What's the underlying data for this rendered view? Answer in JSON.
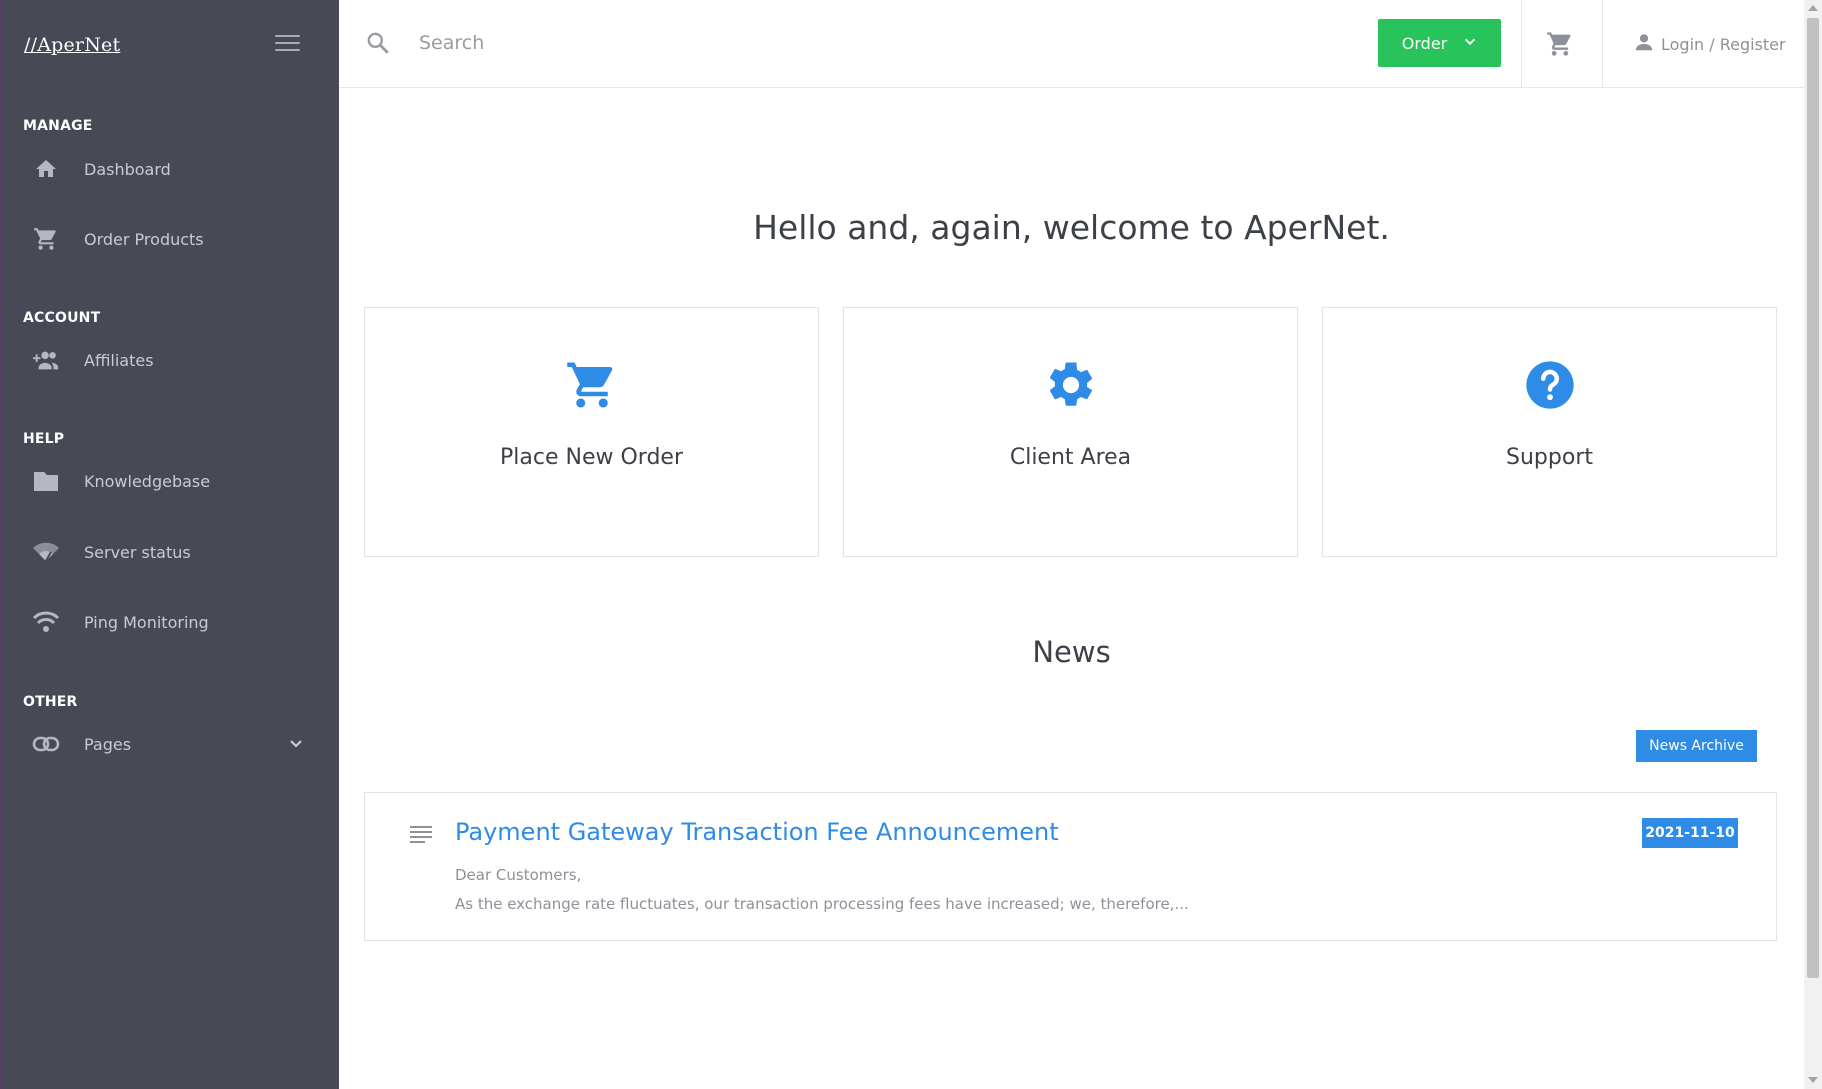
{
  "brand": {
    "name": "//AperNet"
  },
  "sidebar": {
    "sections": [
      {
        "title": "MANAGE"
      },
      {
        "title": "ACCOUNT"
      },
      {
        "title": "HELP"
      },
      {
        "title": "OTHER"
      }
    ],
    "items": [
      {
        "label": "Dashboard",
        "icon": "home-icon"
      },
      {
        "label": "Order Products",
        "icon": "cart-icon"
      },
      {
        "label": "Affiliates",
        "icon": "group-add-icon"
      },
      {
        "label": "Knowledgebase",
        "icon": "folder-icon"
      },
      {
        "label": "Server status",
        "icon": "signal-icon"
      },
      {
        "label": "Ping Monitoring",
        "icon": "wifi-icon"
      },
      {
        "label": "Pages",
        "icon": "link-icon"
      }
    ]
  },
  "topbar": {
    "search_placeholder": "Search",
    "order_label": "Order",
    "login_label": "Login / Register"
  },
  "main": {
    "welcome": "Hello and, again, welcome to AperNet.",
    "cards": [
      {
        "label": "Place New Order",
        "icon": "cart-icon"
      },
      {
        "label": "Client Area",
        "icon": "gear-icon"
      },
      {
        "label": "Support",
        "icon": "help-icon"
      }
    ],
    "news_title": "News",
    "archive_label": "News Archive",
    "news": [
      {
        "title": "Payment Gateway Transaction Fee Announcement",
        "date": "2021-11-10",
        "line1": "Dear Customers,",
        "line2": "As the exchange rate fluctuates, our transaction processing fees have increased; we, therefore,..."
      }
    ]
  },
  "colors": {
    "sidebar_bg": "#474a55",
    "accent_blue": "#2e8be6",
    "order_green": "#28c35b"
  }
}
